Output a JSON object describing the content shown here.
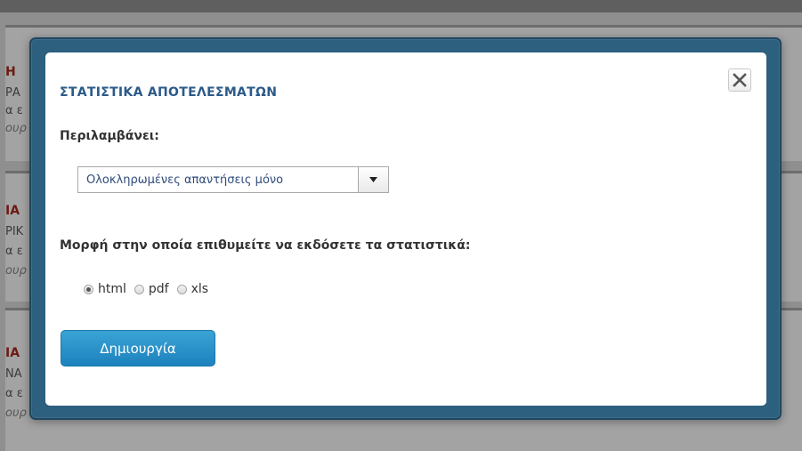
{
  "background": {
    "cards": [
      {
        "lines": [
          "Η ",
          "ΡΑ",
          "α ε",
          "ουρ"
        ]
      },
      {
        "lines": [
          "ΙΑ",
          "ΡΙΚ",
          "α ε",
          "ουρ"
        ]
      },
      {
        "lines": [
          "ΙΑ",
          "ΝΑ",
          "α ε",
          "ουρ"
        ]
      }
    ]
  },
  "dialog": {
    "title": "ΣΤΑΤΙΣΤΙΚΑ ΑΠΟΤΕΛΕΣΜΑΤΩΝ",
    "includes_label": "Περιλαμβάνει:",
    "includes_select": {
      "selected": "Ολοκληρωμένες απαντήσεις μόνο"
    },
    "format_label": "Μορφή στην οποία επιθυμείτε να εκδόσετε τα στατιστικά:",
    "formats": [
      {
        "label": "html",
        "checked": true
      },
      {
        "label": "pdf",
        "checked": false
      },
      {
        "label": "xls",
        "checked": false
      }
    ],
    "create_button": "Δημιουργία"
  },
  "colors": {
    "title": "#2b5a8a",
    "frame": "#2d5f7f",
    "button": "#1d82bd"
  }
}
